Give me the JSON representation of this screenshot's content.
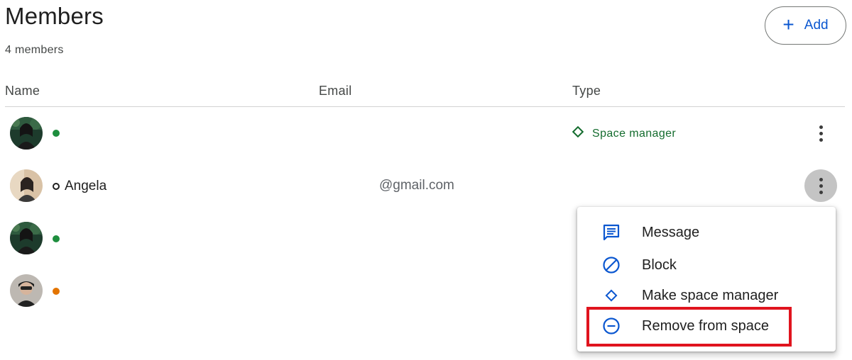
{
  "header": {
    "title": "Members",
    "member_count": "4 members",
    "add_label": "Add"
  },
  "table": {
    "columns": [
      "Name",
      "Email",
      "Type"
    ],
    "rows": [
      {
        "name": "",
        "email": "",
        "type": "Space manager",
        "status": "online"
      },
      {
        "name": "Angela",
        "email": "@gmail.com",
        "type": "",
        "status": "offline"
      },
      {
        "name": "",
        "email": "",
        "type": "",
        "status": "online"
      },
      {
        "name": "",
        "email": "",
        "type": "",
        "status": "away"
      }
    ]
  },
  "menu": {
    "items": [
      {
        "label": "Message",
        "icon": "message-icon"
      },
      {
        "label": "Block",
        "icon": "block-icon"
      },
      {
        "label": "Make space manager",
        "icon": "diamond-icon"
      },
      {
        "label": "Remove from space",
        "icon": "remove-icon"
      }
    ]
  },
  "colors": {
    "accent": "#0b57d0",
    "online": "#1e8e3e",
    "away": "#e37400",
    "space_manager": "#146c2e",
    "highlight": "#e0141e"
  }
}
